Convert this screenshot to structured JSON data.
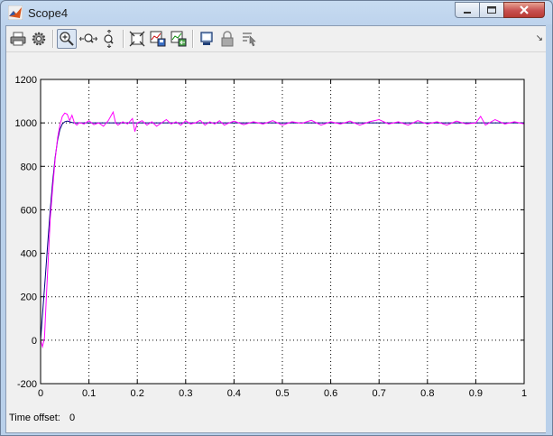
{
  "window": {
    "title": "Scope4"
  },
  "toolbar": {
    "icons": [
      "print-icon",
      "parameters-icon",
      "zoom-in-icon",
      "zoom-x-icon",
      "zoom-y-icon",
      "autoscale-icon",
      "save-axes-icon",
      "restore-axes-icon",
      "floating-scope-icon",
      "lock-icon",
      "signal-selection-icon",
      "dock-icon"
    ]
  },
  "footer": {
    "time_offset_label": "Time offset:",
    "time_offset_value": "0"
  },
  "colors": {
    "plot_bg": "#ffffff",
    "reference": "#000080",
    "signal": "#ff00ff",
    "grid": "#000000"
  },
  "chart_data": {
    "type": "line",
    "title": "",
    "xlabel": "",
    "ylabel": "",
    "xlim": [
      0,
      1
    ],
    "ylim": [
      -200,
      1200
    ],
    "xticks": [
      "0",
      "0.1",
      "0.2",
      "0.3",
      "0.4",
      "0.5",
      "0.6",
      "0.7",
      "0.8",
      "0.9",
      "1"
    ],
    "yticks": [
      "-200",
      "0",
      "200",
      "400",
      "600",
      "800",
      "1000",
      "1200"
    ],
    "grid": true,
    "series": [
      {
        "color": "#000080",
        "x": [
          0,
          0.005,
          0.01,
          0.015,
          0.02,
          0.025,
          0.03,
          0.035,
          0.04,
          0.045,
          0.05,
          0.055,
          0.06,
          0.065,
          0.07,
          0.08,
          0.1,
          0.2,
          0.3,
          0.4,
          0.5,
          0.6,
          0.7,
          0.8,
          0.9,
          1.0
        ],
        "values": [
          0,
          150,
          300,
          450,
          600,
          730,
          840,
          920,
          970,
          995,
          1005,
          1008,
          1005,
          1002,
          1000,
          1000,
          1000,
          1000,
          1000,
          1000,
          1000,
          1000,
          1000,
          1000,
          1000,
          1000
        ]
      },
      {
        "color": "#ff00ff",
        "x": [
          0,
          0.004,
          0.008,
          0.012,
          0.016,
          0.02,
          0.025,
          0.03,
          0.035,
          0.04,
          0.045,
          0.05,
          0.055,
          0.06,
          0.065,
          0.07,
          0.075,
          0.08,
          0.09,
          0.1,
          0.11,
          0.12,
          0.13,
          0.14,
          0.15,
          0.155,
          0.16,
          0.17,
          0.18,
          0.19,
          0.195,
          0.2,
          0.21,
          0.22,
          0.23,
          0.24,
          0.25,
          0.26,
          0.27,
          0.28,
          0.29,
          0.3,
          0.31,
          0.32,
          0.33,
          0.34,
          0.35,
          0.36,
          0.37,
          0.38,
          0.39,
          0.4,
          0.42,
          0.44,
          0.46,
          0.48,
          0.5,
          0.52,
          0.54,
          0.56,
          0.58,
          0.6,
          0.62,
          0.64,
          0.66,
          0.68,
          0.7,
          0.72,
          0.74,
          0.76,
          0.78,
          0.8,
          0.82,
          0.84,
          0.86,
          0.88,
          0.9,
          0.91,
          0.92,
          0.94,
          0.96,
          0.98,
          1.0
        ],
        "values": [
          0,
          -30,
          10,
          200,
          380,
          560,
          700,
          830,
          930,
          990,
          1030,
          1045,
          1040,
          1010,
          1035,
          1000,
          990,
          1002,
          995,
          1010,
          992,
          1000,
          985,
          1010,
          1050,
          1000,
          990,
          1005,
          995,
          1020,
          960,
          1000,
          1010,
          990,
          1005,
          985,
          1000,
          1015,
          995,
          1005,
          990,
          1010,
          995,
          1000,
          1012,
          990,
          1005,
          995,
          1010,
          990,
          1000,
          1008,
          992,
          1005,
          995,
          1010,
          990,
          1005,
          998,
          1012,
          990,
          1005,
          995,
          1008,
          990,
          1005,
          1015,
          995,
          1005,
          990,
          1010,
          995,
          1005,
          990,
          1008,
          995,
          1000,
          1030,
          990,
          1015,
          995,
          1005,
          995
        ]
      }
    ]
  }
}
